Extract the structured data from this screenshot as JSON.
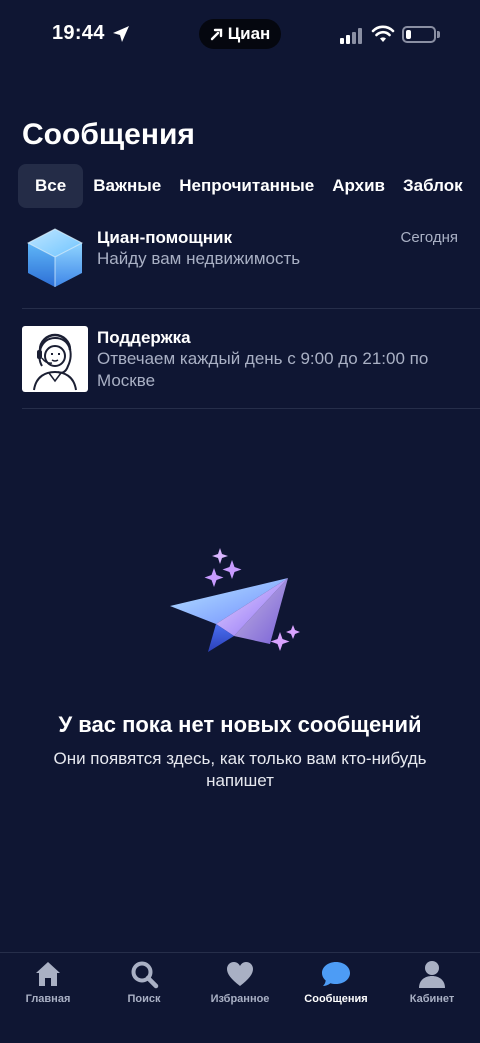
{
  "status_bar": {
    "time": "19:44",
    "carrier_pill": "Циан"
  },
  "page": {
    "title": "Сообщения"
  },
  "tabs": [
    {
      "label": "Все",
      "active": true
    },
    {
      "label": "Важные",
      "active": false
    },
    {
      "label": "Непрочитанные",
      "active": false
    },
    {
      "label": "Архив",
      "active": false
    },
    {
      "label": "Заблок",
      "active": false
    }
  ],
  "chats": [
    {
      "name": "Циан-помощник",
      "preview": "Найду вам недвижимость",
      "date": "Сегодня",
      "avatar_icon": "cube-icon"
    },
    {
      "name": "Поддержка",
      "preview": "Отвечаем каждый день с 9:00 до 21:00 по Москве",
      "date": "",
      "avatar_icon": "support-agent-icon"
    }
  ],
  "empty_state": {
    "title": "У вас пока нет новых сообщений",
    "subtitle": "Они появятся здесь, как только вам кто-нибудь напишет",
    "icon": "paper-plane-icon"
  },
  "bottom_nav": [
    {
      "label": "Главная",
      "icon": "home-icon",
      "active": false
    },
    {
      "label": "Поиск",
      "icon": "search-icon",
      "active": false
    },
    {
      "label": "Избранное",
      "icon": "heart-icon",
      "active": false
    },
    {
      "label": "Сообщения",
      "icon": "chat-bubble-icon",
      "active": true
    },
    {
      "label": "Кабинет",
      "icon": "user-icon",
      "active": false
    }
  ],
  "colors": {
    "background": "#0f1633",
    "accent": "#4d9cf5",
    "muted_text": "#a9b0c4"
  }
}
